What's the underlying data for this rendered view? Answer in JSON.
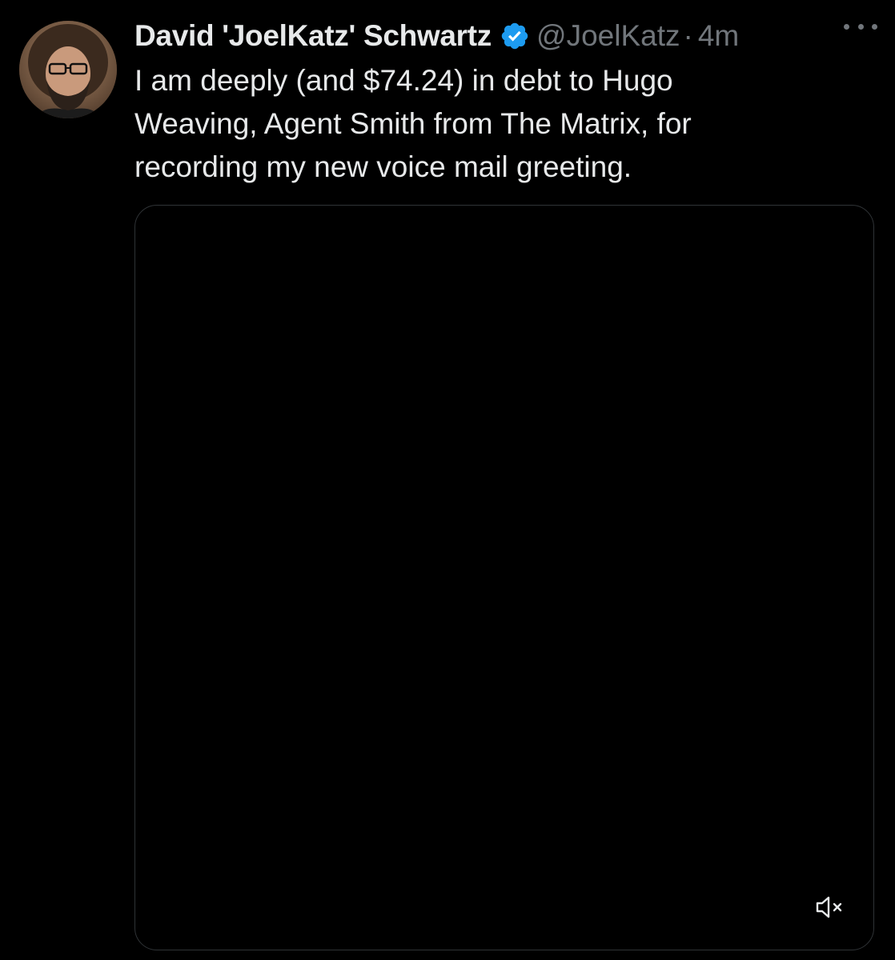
{
  "tweet": {
    "author": {
      "display_name": "David 'JoelKatz' Schwartz",
      "handle": "@JoelKatz",
      "verified": true,
      "verified_color": "#1d9bf0"
    },
    "separator": "·",
    "timestamp": "4m",
    "text_lines": [
      "I am deeply (and $74.24) in debt to Hugo",
      "Weaving, Agent Smith from The Matrix, for",
      "recording my new voice mail greeting."
    ],
    "media": {
      "type": "video",
      "muted": true
    }
  },
  "icons": {
    "verified": "verified-badge-icon",
    "more": "more-horizontal-icon",
    "mute": "volume-muted-icon"
  },
  "colors": {
    "background": "#000000",
    "text_primary": "#e7e9ea",
    "text_secondary": "#71767b",
    "border": "#2f3336"
  }
}
